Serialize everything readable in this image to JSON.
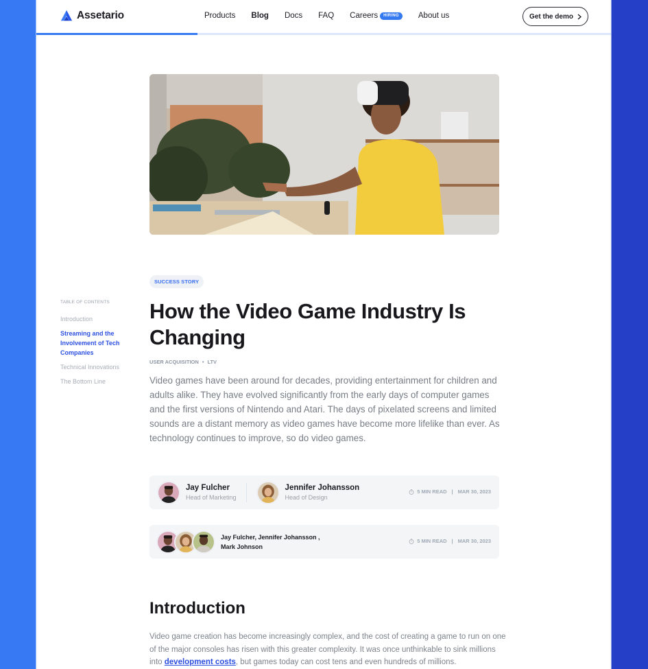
{
  "brand": {
    "name": "Assetario",
    "accent": "#3579f0"
  },
  "nav": {
    "items": [
      {
        "label": "Products"
      },
      {
        "label": "Blog",
        "active": true
      },
      {
        "label": "Docs"
      },
      {
        "label": "FAQ"
      },
      {
        "label": "Careers",
        "badge": "HIRING"
      },
      {
        "label": "About us"
      }
    ],
    "cta": "Get the demo",
    "cta_icon": "chevron-right-icon"
  },
  "reading_progress": 0.28,
  "hero_image": {
    "alt": "Person in yellow t-shirt wearing VR headset at a desk"
  },
  "toc": {
    "title": "TABLE OF CONTENTS",
    "items": [
      {
        "label": "Introduction"
      },
      {
        "label": "Streaming and the Involvement of Tech Companies",
        "active": true
      },
      {
        "label": "Technical Innovations"
      },
      {
        "label": "The Bottom Line"
      }
    ]
  },
  "article": {
    "category": "SUCCESS STORY",
    "title": "How the Video Game Industry Is Changing",
    "tags": [
      "USER ACQUISITION",
      "LTV"
    ],
    "tag_separator": "•",
    "lede": "Video games have been around for decades, providing entertainment for children and adults alike. They have evolved significantly from the early days of computer games and the first versions of Nintendo and Atari. The days of pixelated screens and limited sounds are a distant memory as video games have become more lifelike than ever. As technology continues to improve, so do video games.",
    "authors_card": {
      "authors": [
        {
          "name": "Jay Fulcher",
          "role": "Head of Marketing"
        },
        {
          "name": "Jennifer Johansson",
          "role": "Head of Design"
        }
      ],
      "read_time": "5 MIN READ",
      "date": "MAR 30, 2023"
    },
    "multi_author_card": {
      "names_line1": "Jay Fulcher, Jennifer Johansson ,",
      "names_line2": "Mark Johnson",
      "read_time": "5 MIN READ",
      "date": "MAR 30, 2023"
    },
    "meta_separator": "|",
    "section": {
      "heading": "Introduction",
      "text_before_link": "Video game creation has become increasingly complex, and the cost of creating a game to run on one of the major consoles has risen with this greater complexity. It was once unthinkable to sink millions into ",
      "link_text": "development costs",
      "text_after_link": ", but games today can cost tens and even hundreds of millions."
    }
  }
}
